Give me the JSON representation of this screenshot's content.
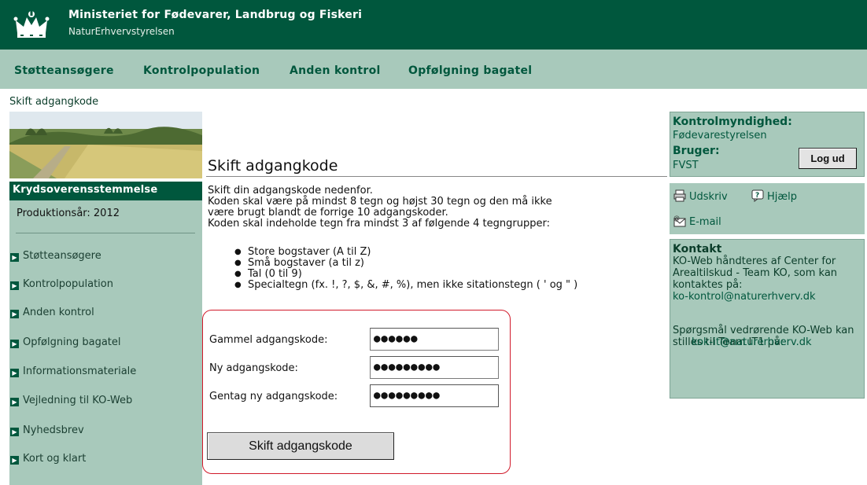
{
  "header": {
    "ministry": "Ministeriet for Fødevarer, Landbrug og Fiskeri",
    "agency": "NaturErhvervstyrelsen"
  },
  "nav": [
    "Støtteansøgere",
    "Kontrolpopulation",
    "Anden kontrol",
    "Opfølgning bagatel"
  ],
  "breadcrumb": "Skift adgangkode",
  "sidebar": {
    "section_title": "Krydsoverensstemmelse",
    "production_year": "Produktionsår: 2012",
    "items": [
      "Støtteansøgere",
      "Kontrolpopulation",
      "Anden kontrol",
      "Opfølgning bagatel",
      "Informationsmateriale",
      "Vejledning til KO-Web",
      "Nyhedsbrev",
      "Kort og klart"
    ]
  },
  "main": {
    "title": "Skift adgangkode",
    "intro": [
      "Skift din adgangskode nedenfor.",
      "Koden skal være på mindst 8 tegn og højst 30 tegn og den må ikke",
      "være brugt blandt de forrige 10 adgangskoder.",
      "Koden skal indeholde tegn fra mindst 3 af følgende 4 tegngrupper:"
    ],
    "rules": [
      "Store bogstaver (A til Z)",
      "Små bogstaver (a til z)",
      "Tal (0 til 9)",
      "Specialtegn (fx. !, ?, $, &, #, %), men ikke sitationstegn ( ' og \" )"
    ],
    "form": {
      "old_label": "Gammel adgangskode:",
      "old_value": "●●●●●●",
      "new_label": "Ny adgangskode:",
      "new_value": "●●●●●●●●●",
      "repeat_label": "Gentag ny adgangskode:",
      "repeat_value": "●●●●●●●●●",
      "submit": "Skift adgangskode"
    }
  },
  "right": {
    "authority_label": "Kontrolmyndighed:",
    "authority": "Fødevarestyrelsen",
    "user_label": "Bruger:",
    "user": "FVST",
    "logout": "Log ud",
    "print": "Udskriv",
    "help": "Hjælp",
    "email": "E-mail",
    "contact_title": "Kontakt",
    "contact_text1": "KO-Web håndteres af Center for Arealtilskud - Team KO, som kan kontaktes på:",
    "contact_email1": "ko-kontrol@naturerhverv.dk",
    "contact_text2": "Spørgsmål vedrørende KO-Web kan stilles til Team IT1 på:",
    "contact_email2": "kok-it@naturerhverv.dk"
  },
  "colors": {
    "dark_green": "#00573d",
    "sage": "#a8c9bb",
    "form_border": "#d11a2a"
  }
}
